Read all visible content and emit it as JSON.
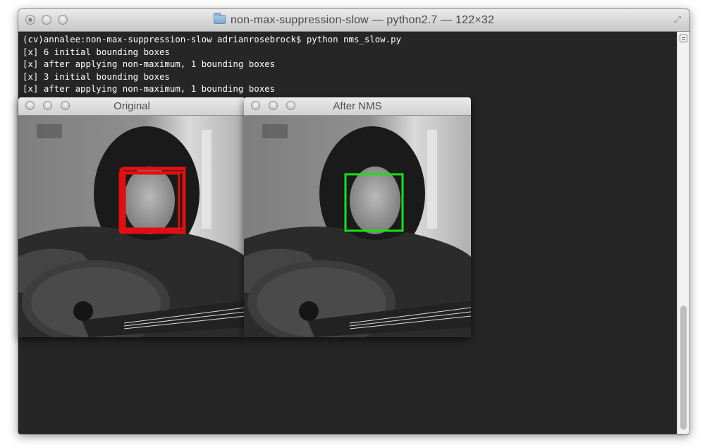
{
  "terminal": {
    "title": "non-max-suppression-slow — python2.7 — 122×32",
    "lines": [
      "(cv)annalee:non-max-suppression-slow adrianrosebrock$ python nms_slow.py",
      "[x] 6 initial bounding boxes",
      "[x] after applying non-maximum, 1 bounding boxes",
      "[x] 3 initial bounding boxes",
      "[x] after applying non-maximum, 1 bounding boxes"
    ]
  },
  "windows": {
    "original": {
      "title": "Original"
    },
    "after": {
      "title": "After NMS"
    }
  },
  "colors": {
    "terminal_bg": "#262626",
    "terminal_text": "#ffffff",
    "box_before": "#e01010",
    "box_after": "#19e019"
  },
  "icons": {
    "folder": "folder-icon",
    "resize": "fullscreen-icon"
  }
}
